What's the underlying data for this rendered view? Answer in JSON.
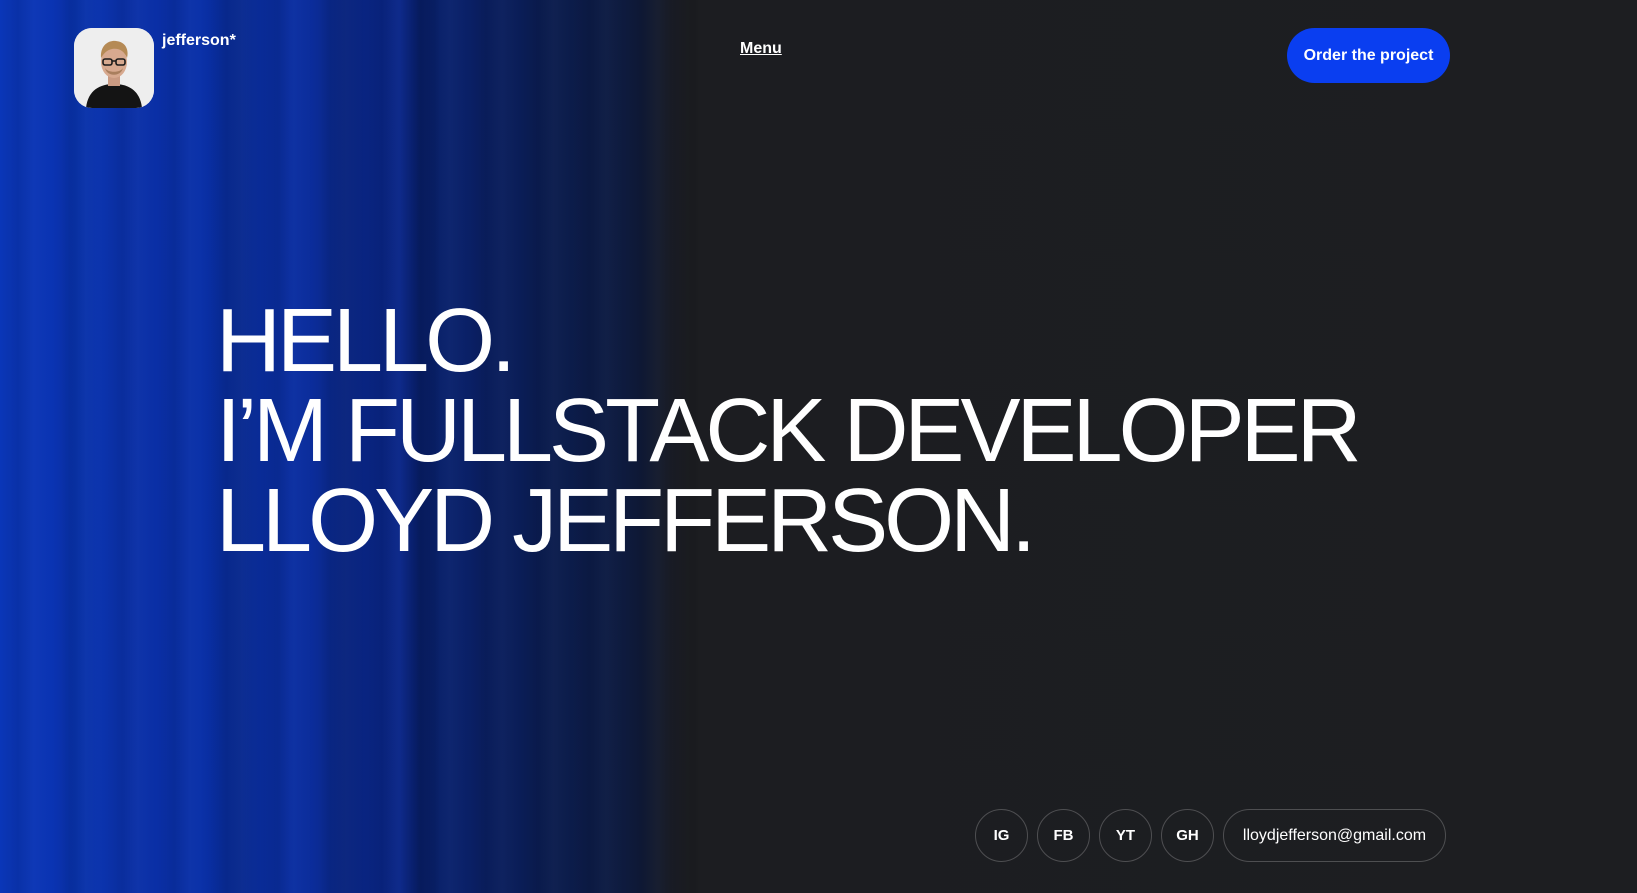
{
  "brand": {
    "name": "jefferson*",
    "avatar_icon": "person-portrait-icon"
  },
  "nav": {
    "menu_label": "Menu"
  },
  "cta": {
    "order_label": "Order the project",
    "color": "#0a3ef0"
  },
  "hero": {
    "lines": [
      "HELLO.",
      "I’M FULLSTACK DEVELOPER",
      "LLOYD JEFFERSON."
    ]
  },
  "socials": [
    {
      "label": "IG"
    },
    {
      "label": "FB"
    },
    {
      "label": "YT"
    },
    {
      "label": "GH"
    }
  ],
  "contact": {
    "email": "lloydjefferson@gmail.com"
  },
  "colors": {
    "background": "#1d1e21",
    "accent_blue": "#0a36b8",
    "text": "#ffffff"
  }
}
